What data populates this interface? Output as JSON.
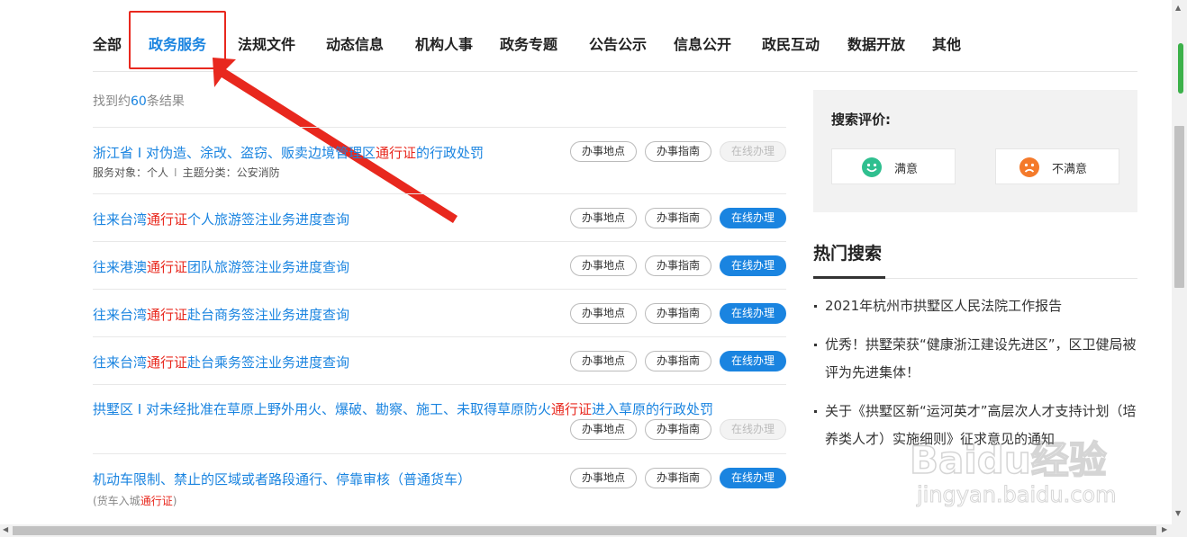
{
  "tabs": [
    {
      "label": "全部",
      "active": false
    },
    {
      "label": "政务服务",
      "active": true
    },
    {
      "label": "法规文件",
      "active": false
    },
    {
      "label": "动态信息",
      "active": false
    },
    {
      "label": "机构人事",
      "active": false
    },
    {
      "label": "政务专题",
      "active": false
    },
    {
      "label": "公告公示",
      "active": false
    },
    {
      "label": "信息公开",
      "active": false
    },
    {
      "label": "政民互动",
      "active": false
    },
    {
      "label": "数据开放",
      "active": false
    },
    {
      "label": "其他",
      "active": false
    }
  ],
  "result_count": {
    "prefix": "找到约",
    "number": "60",
    "suffix": "条结果"
  },
  "buttons": {
    "location": "办事地点",
    "guide": "办事指南",
    "online": "在线办理"
  },
  "results": [
    {
      "title_pre": "浙江省 I 对伪造、涂改、盗窃、贩卖边境管理区",
      "keyword": "通行证",
      "title_post": "的行政处罚",
      "sub_label1": "服务对象：个人",
      "sub_sep": "I",
      "sub_label2": "主题分类：公安消防",
      "online_enabled": false
    },
    {
      "title_pre": "往来台湾",
      "keyword": "通行证",
      "title_post": "个人旅游签注业务进度查询",
      "online_enabled": true
    },
    {
      "title_pre": "往来港澳",
      "keyword": "通行证",
      "title_post": "团队旅游签注业务进度查询",
      "online_enabled": true
    },
    {
      "title_pre": "往来台湾",
      "keyword": "通行证",
      "title_post": "赴台商务签注业务进度查询",
      "online_enabled": true
    },
    {
      "title_pre": "往来台湾",
      "keyword": "通行证",
      "title_post": "赴台乘务签注业务进度查询",
      "online_enabled": true
    },
    {
      "title_pre": "拱墅区 I 对未经批准在草原上野外用火、爆破、勘察、施工、未取得草原防火",
      "keyword": "通行证",
      "title_post": "进入草原的行政处罚",
      "online_enabled": false
    },
    {
      "title_pre": "机动车限制、禁止的区域或者路段通行、停靠审核（普通货车）",
      "keyword": "",
      "title_post": "",
      "note_pre": "(货车入城",
      "note_keyword": "通行证",
      "note_post": ")",
      "online_enabled": true
    }
  ],
  "evaluation": {
    "title": "搜索评价:",
    "satisfied": "满意",
    "unsatisfied": "不满意"
  },
  "hot_search": {
    "title": "热门搜索",
    "items": [
      "2021年杭州市拱墅区人民法院工作报告",
      "优秀！拱墅荣获“健康浙江建设先进区”，区卫健局被评为先进集体！",
      "关于《拱墅区新“运河英才”高层次人才支持计划（培养类人才）实施细则》征求意见的通知"
    ]
  },
  "watermark": {
    "brand": "Baidu经验",
    "url": "jingyan.baidu.com"
  },
  "colors": {
    "accent": "#1a84e0",
    "keyword": "#e8281e",
    "highlight_box": "#e8281e",
    "satisfied_face": "#2fbf8f",
    "unsatisfied_face": "#f47a2b"
  }
}
